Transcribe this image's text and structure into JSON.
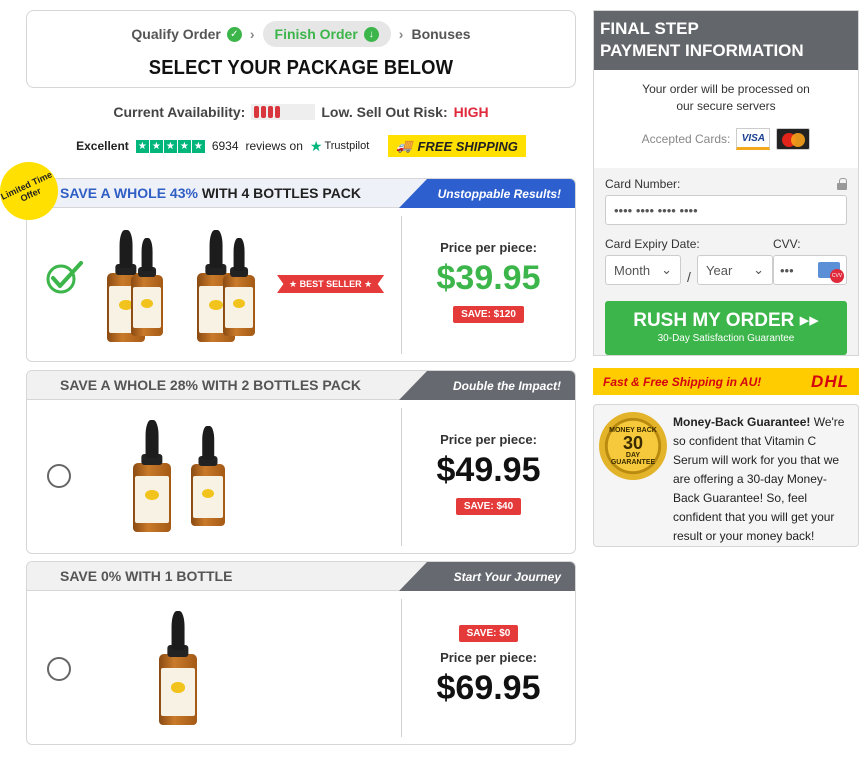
{
  "steps": {
    "qualify": "Qualify Order",
    "finish": "Finish Order",
    "bonuses": "Bonuses",
    "separator": "›",
    "title": "SELECT YOUR PACKAGE BELOW"
  },
  "availability": {
    "label": "Current Availability:",
    "meter_level": 0.35,
    "status": "Low. Sell Out Risk:",
    "risk": "HIGH"
  },
  "rating": {
    "label": "Excellent",
    "count": "6934",
    "reviews_on": "reviews on",
    "brand": "Trustpilot",
    "free_shipping": "FREE SHIPPING"
  },
  "ribbon": "Limited Time Offer",
  "packages": [
    {
      "title_highlight": "SAVE A WHOLE 43%",
      "title_rest": " WITH 4 BOTTLES PACK",
      "tag": "Unstoppable Results!",
      "badge": "★ BEST SELLER ★",
      "price_label": "Price per piece:",
      "price": "$39.95",
      "save": "SAVE: $120",
      "selected": true
    },
    {
      "title": "SAVE A WHOLE 28% WITH 2 BOTTLES PACK",
      "tag": "Double the Impact!",
      "price_label": "Price per piece:",
      "price": "$49.95",
      "save": "SAVE: $40",
      "selected": false
    },
    {
      "title": "SAVE 0% WITH 1 BOTTLE",
      "tag": "Start Your Journey",
      "price_label": "Price per piece:",
      "price": "$69.95",
      "save": "SAVE: $0",
      "selected": false
    }
  ],
  "payment": {
    "title_line1": "FINAL STEP",
    "title_line2": "PAYMENT INFORMATION",
    "info_line1": "Your order will be processed on",
    "info_line2": "our secure servers",
    "accepted": "Accepted Cards:",
    "visa": "VISA",
    "card_label": "Card Number:",
    "card_placeholder": "•••• •••• •••• ••••",
    "expiry_label": "Card Expiry Date:",
    "month": "Month",
    "year": "Year",
    "slash": "/",
    "cvv_label": "CVV:",
    "cvv_placeholder": "•••",
    "button": "RUSH MY ORDER ▸▸",
    "button_sub": "30-Day Satisfaction Guarantee"
  },
  "shipping": {
    "text": "Fast & Free Shipping in AU!",
    "carrier": "DHL"
  },
  "guarantee": {
    "seal_top": "MONEY BACK",
    "seal_num": "30",
    "seal_day": "DAY",
    "seal_bottom": "GUARANTEE",
    "bold": "Money-Back Guarantee!",
    "text": " We're so confident that Vitamin C Serum will work for you that we are offering a 30-day Money-Back Guarantee! So, feel confident that you will get your result or your money back!"
  }
}
